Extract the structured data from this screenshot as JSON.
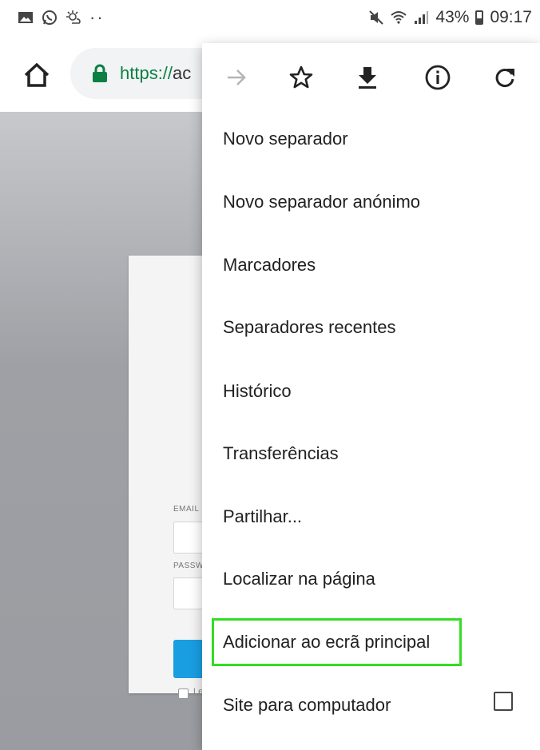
{
  "status_bar": {
    "battery": "43%",
    "time": "09:17",
    "icons": [
      "image-icon",
      "whatsapp-icon",
      "weather-icon",
      "more-notifications-icon",
      "mute-icon",
      "wifi-icon",
      "signal-icon",
      "battery-icon"
    ]
  },
  "toolbar": {
    "url_scheme": "https://",
    "url_rest": "ac",
    "icons": [
      "home-icon",
      "lock-icon"
    ]
  },
  "page": {
    "email_label": "EMAIL",
    "password_label": "PASSW",
    "remember_label": "Le"
  },
  "menu": {
    "icons": [
      "forward-icon",
      "bookmark-star-icon",
      "download-icon",
      "info-icon",
      "reload-icon"
    ],
    "items": [
      {
        "label": "Novo separador"
      },
      {
        "label": "Novo separador anónimo"
      },
      {
        "label": "Marcadores"
      },
      {
        "label": "Separadores recentes"
      },
      {
        "label": "Histórico"
      },
      {
        "label": "Transferências"
      },
      {
        "label": "Partilhar..."
      },
      {
        "label": "Localizar na página"
      },
      {
        "label": "Adicionar ao ecrã principal"
      },
      {
        "label": "Site para computador"
      }
    ],
    "desktop_site_checked": false
  },
  "colors": {
    "highlight": "#33dd22",
    "secure_green": "#0b8043",
    "login_button": "#1a9ee2"
  }
}
